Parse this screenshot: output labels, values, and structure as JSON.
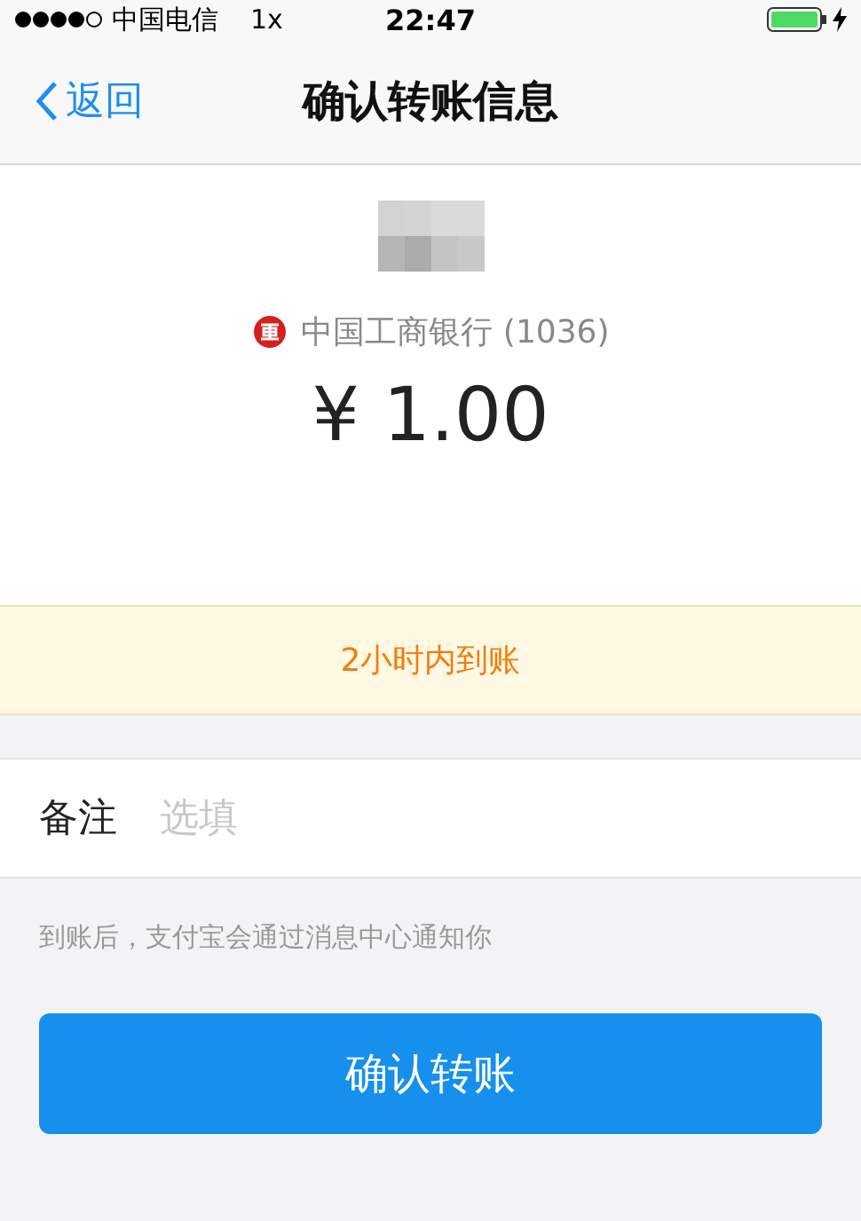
{
  "status_bar": {
    "carrier": "中国电信",
    "zoom": "1x",
    "time": "22:47"
  },
  "nav": {
    "back": "返回",
    "title": "确认转账信息"
  },
  "payee": {
    "bank": "中国工商银行 (1036)",
    "amount": "¥ 1.00"
  },
  "notice": "2小时内到账",
  "remark": {
    "label": "备注",
    "placeholder": "选填"
  },
  "hint": "到账后，支付宝会通过消息中心通知你",
  "confirm_button": "确认转账"
}
